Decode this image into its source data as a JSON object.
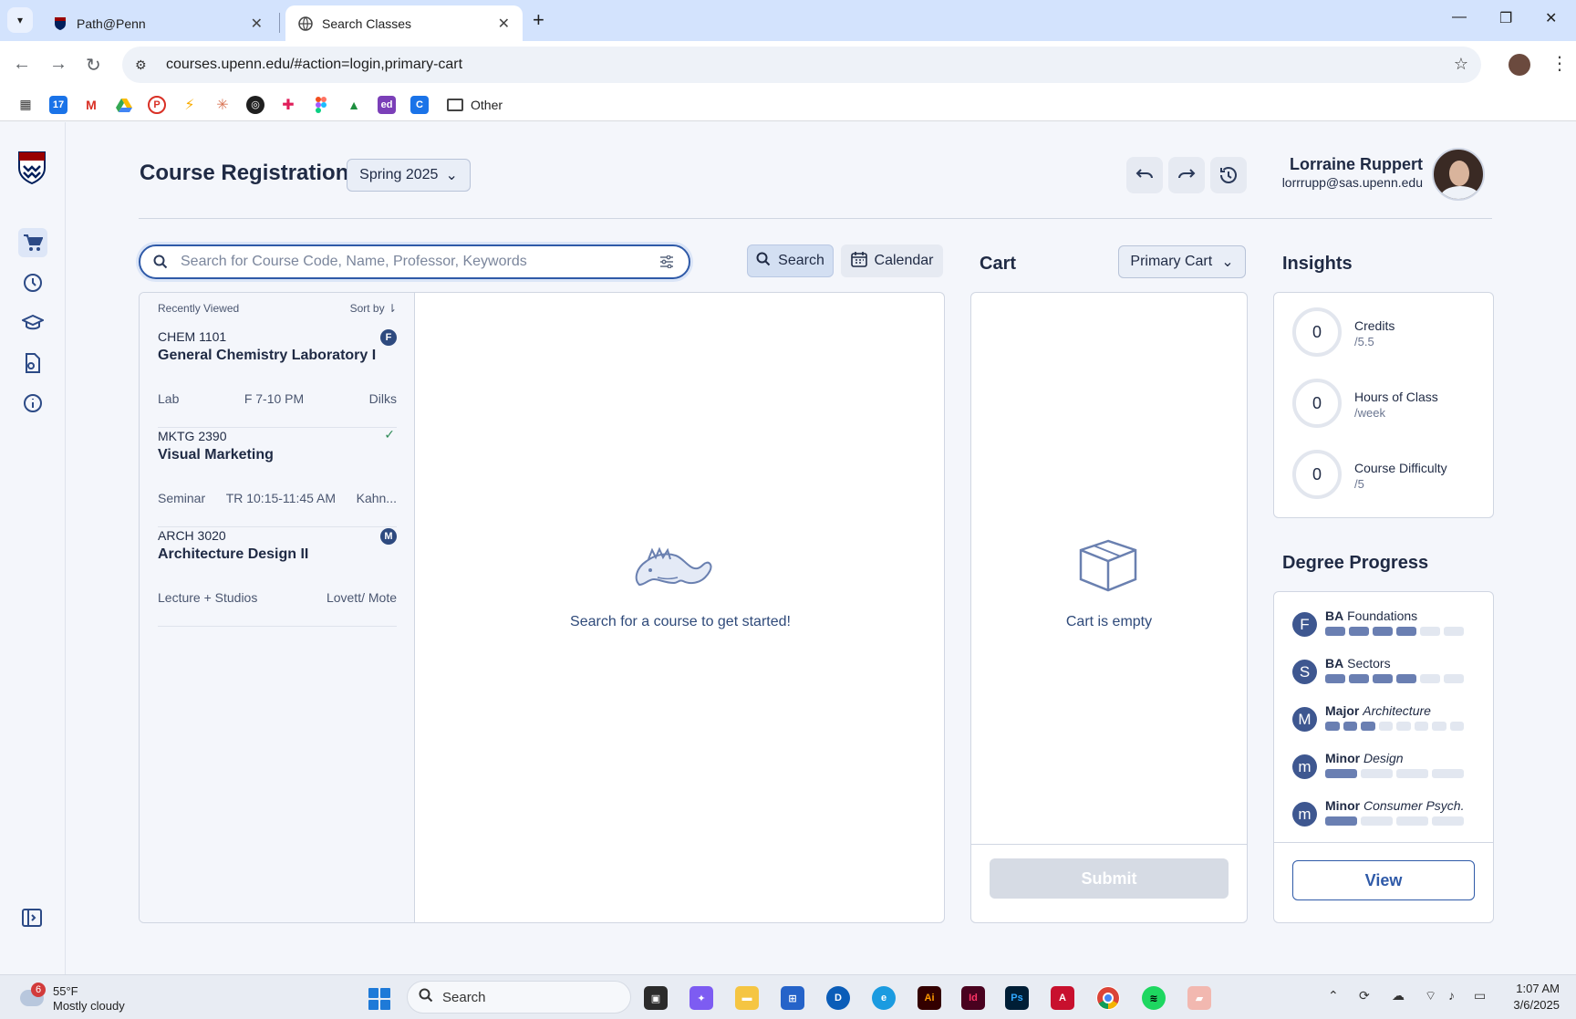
{
  "browser": {
    "tabs": [
      {
        "title": "Path@Penn",
        "active": false
      },
      {
        "title": "Search Classes",
        "active": true
      }
    ],
    "url": "courses.upenn.edu/#action=login,primary-cart",
    "bookmarks_other": "Other"
  },
  "header": {
    "title": "Course Registration",
    "term": "Spring 2025",
    "user_name": "Lorraine Ruppert",
    "user_email": "lorrrupp@sas.upenn.edu"
  },
  "search": {
    "placeholder": "Search for Course Code, Name, Professor, Keywords",
    "search_label": "Search",
    "calendar_label": "Calendar"
  },
  "recent": {
    "heading": "Recently Viewed",
    "sort_label": "Sort by",
    "courses": [
      {
        "code": "CHEM 1101",
        "name": "General Chemistry Laboratory I",
        "type": "Lab",
        "time": "F 7-10 PM",
        "instructor": "Dilks",
        "badge": "F"
      },
      {
        "code": "MKTG 2390",
        "name": "Visual Marketing",
        "type": "Seminar",
        "time": "TR 10:15-11:45 AM",
        "instructor": "Kahn...",
        "badge": "check"
      },
      {
        "code": "ARCH 3020",
        "name": "Architecture Design II",
        "type": "Lecture + Studios",
        "time": "",
        "instructor": "Lovett/ Mote",
        "badge": "M"
      }
    ]
  },
  "results": {
    "empty_message": "Search for a course to get started!"
  },
  "cart": {
    "title": "Cart",
    "selector": "Primary Cart",
    "empty_message": "Cart is empty",
    "submit_label": "Submit"
  },
  "insights": {
    "title": "Insights",
    "stats": [
      {
        "value": "0",
        "label": "Credits",
        "sub": "/5.5"
      },
      {
        "value": "0",
        "label": "Hours of Class",
        "sub": "/week"
      },
      {
        "value": "0",
        "label": "Course Difficulty",
        "sub": "/5"
      }
    ]
  },
  "degree": {
    "title": "Degree Progress",
    "items": [
      {
        "letter": "F",
        "bold": "BA",
        "plain": "Foundations",
        "italic": "",
        "segments": 6,
        "filled": 4
      },
      {
        "letter": "S",
        "bold": "BA",
        "plain": "Sectors",
        "italic": "",
        "segments": 6,
        "filled": 4
      },
      {
        "letter": "M",
        "bold": "Major",
        "plain": "",
        "italic": "Architecture",
        "segments": 8,
        "filled": 3
      },
      {
        "letter": "m",
        "bold": "Minor",
        "plain": "",
        "italic": "Design",
        "segments": 4,
        "filled": 1
      },
      {
        "letter": "m",
        "bold": "Minor",
        "plain": "",
        "italic": "Consumer Psych.",
        "segments": 4,
        "filled": 1
      }
    ],
    "view_label": "View"
  },
  "taskbar": {
    "weather_temp": "55°F",
    "weather_cond": "Mostly cloudy",
    "weather_badge": "6",
    "search_label": "Search",
    "time": "1:07 AM",
    "date": "3/6/2025"
  },
  "colors": {
    "accent": "#2f5aa8",
    "navy": "#1f2a44",
    "bar_filled": "#6a7fb2"
  }
}
